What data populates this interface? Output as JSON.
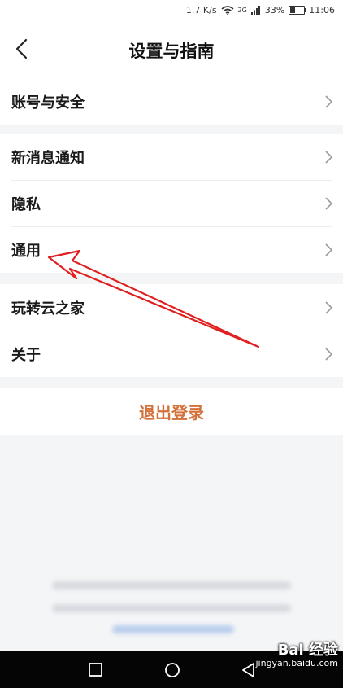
{
  "status_bar": {
    "network_speed": "1.7 K/s",
    "network_type": "2G",
    "battery": "33%",
    "time": "11:06"
  },
  "header": {
    "title": "设置与指南"
  },
  "groups": [
    {
      "items": [
        {
          "label": "账号与安全"
        }
      ]
    },
    {
      "items": [
        {
          "label": "新消息通知"
        },
        {
          "label": "隐私"
        },
        {
          "label": "通用"
        }
      ]
    },
    {
      "items": [
        {
          "label": "玩转云之家"
        },
        {
          "label": "关于"
        }
      ]
    }
  ],
  "logout": {
    "label": "退出登录"
  },
  "watermark": {
    "logo": "Bai 经验",
    "url": "jingyan.baidu.com"
  },
  "colors": {
    "accent": "#d2713a",
    "annotation": "#e02020",
    "background": "#f4f5f7"
  }
}
